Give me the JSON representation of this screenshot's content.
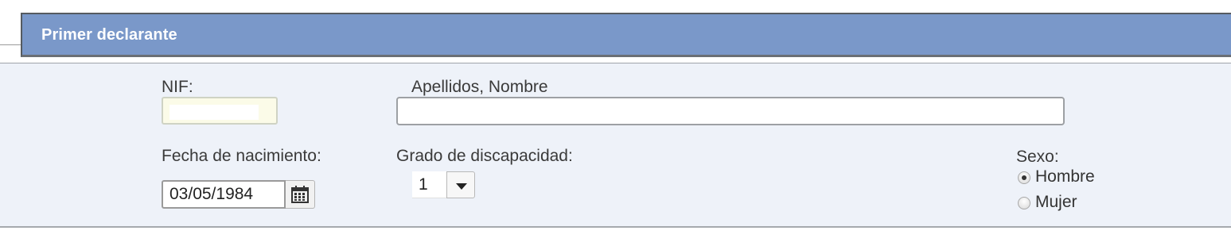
{
  "section": {
    "title": "Primer declarante"
  },
  "fields": {
    "nif": {
      "label": "NIF:",
      "value": ""
    },
    "name": {
      "label": "Apellidos, Nombre",
      "value": ""
    },
    "birth_date": {
      "label": "Fecha de nacimiento:",
      "value": "03/05/1984",
      "icon": "calendar-icon"
    },
    "disability": {
      "label": "Grado de discapacidad:",
      "selected": "1",
      "icon": "caret-down-icon"
    },
    "sex": {
      "label": "Sexo:",
      "options": [
        {
          "label": "Hombre",
          "checked": true
        },
        {
          "label": "Mujer",
          "checked": false
        }
      ]
    }
  },
  "colors": {
    "header_bg": "#7a98c9",
    "panel_bg": "#eef2f9",
    "nif_bg": "#fbfbe8"
  }
}
